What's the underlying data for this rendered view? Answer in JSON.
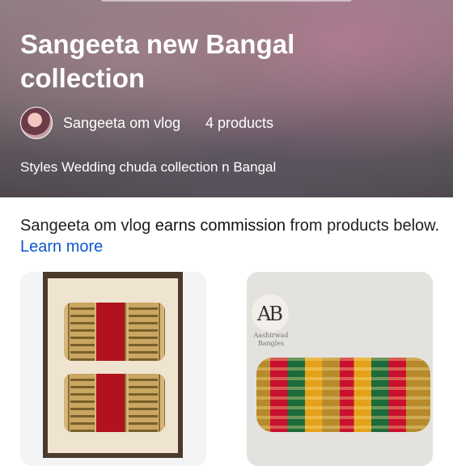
{
  "hero": {
    "title": "Sangeeta new Bangal collection",
    "creator": "Sangeeta om vlog",
    "product_count": "4 products",
    "description": "Styles Wedding chuda collection n Bangal"
  },
  "disclosure": {
    "creator": "Sangeeta om vlog",
    "earns": "earns commission",
    "rest": "from products below.",
    "link": "Learn more"
  },
  "products": [
    {
      "image": "red-gold-bangle-set"
    },
    {
      "image": "multicolor-bangle-set",
      "brand_logo": "AB",
      "brand_name": "Aashirwad Bangles"
    }
  ]
}
